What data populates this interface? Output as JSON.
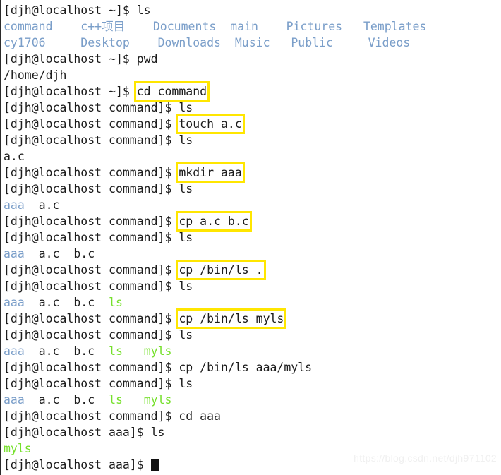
{
  "terminal": {
    "window_title": "djh@localhost",
    "colors": {
      "background": "#ffffff",
      "foreground": "#1c1c1c",
      "directory": "#7a9ec9",
      "executable": "#76e02c",
      "highlight_border": "#ffe600",
      "cursor": "#111111",
      "watermark": "#f0f0f0"
    },
    "prompts": {
      "home": "[djh@localhost ~]$ ",
      "command_dir": "[djh@localhost command]$ ",
      "aaa_dir": "[djh@localhost aaa]$ "
    },
    "lines": [
      {
        "id": "l01",
        "prompt": "home",
        "command": "ls",
        "highlight": false
      },
      {
        "id": "l02",
        "type": "output",
        "items": [
          {
            "text": "command",
            "color": "dir",
            "width": 11
          },
          {
            "text": "c++项目",
            "color": "dir",
            "width": 11
          },
          {
            "text": "Documents",
            "color": "dir",
            "width": 11
          },
          {
            "text": "main",
            "color": "dir",
            "width": 8
          },
          {
            "text": "Pictures",
            "color": "dir",
            "width": 11
          },
          {
            "text": "Templates",
            "color": "dir",
            "width": 11
          }
        ]
      },
      {
        "id": "l03",
        "type": "output",
        "items": [
          {
            "text": "cy1706",
            "color": "dir",
            "width": 11
          },
          {
            "text": "Desktop",
            "color": "dir",
            "width": 11
          },
          {
            "text": "Downloads",
            "color": "dir",
            "width": 11
          },
          {
            "text": "Music",
            "color": "dir",
            "width": 8
          },
          {
            "text": "Public",
            "color": "dir",
            "width": 11
          },
          {
            "text": "Videos",
            "color": "dir",
            "width": 11
          }
        ]
      },
      {
        "id": "l04",
        "prompt": "home",
        "command": "pwd",
        "highlight": false
      },
      {
        "id": "l05",
        "type": "output",
        "items": [
          {
            "text": "/home/djh",
            "color": "default",
            "width": 0
          }
        ]
      },
      {
        "id": "l06",
        "prompt": "home",
        "command": "cd command",
        "highlight": true
      },
      {
        "id": "l07",
        "prompt": "command_dir",
        "command": "ls",
        "highlight": false
      },
      {
        "id": "l08",
        "prompt": "command_dir",
        "command": "touch a.c",
        "highlight": true
      },
      {
        "id": "l09",
        "prompt": "command_dir",
        "command": "ls",
        "highlight": false
      },
      {
        "id": "l10",
        "type": "output",
        "items": [
          {
            "text": "a.c",
            "color": "default",
            "width": 0
          }
        ]
      },
      {
        "id": "l11",
        "prompt": "command_dir",
        "command": "mkdir aaa",
        "highlight": true
      },
      {
        "id": "l12",
        "prompt": "command_dir",
        "command": "ls",
        "highlight": false
      },
      {
        "id": "l13",
        "type": "output",
        "items": [
          {
            "text": "aaa",
            "color": "dir",
            "width": 5
          },
          {
            "text": "a.c",
            "color": "default",
            "width": 0
          }
        ]
      },
      {
        "id": "l14",
        "prompt": "command_dir",
        "command": "cp a.c b.c",
        "highlight": true
      },
      {
        "id": "l15",
        "prompt": "command_dir",
        "command": "ls",
        "highlight": false
      },
      {
        "id": "l16",
        "type": "output",
        "items": [
          {
            "text": "aaa",
            "color": "dir",
            "width": 5
          },
          {
            "text": "a.c",
            "color": "default",
            "width": 5
          },
          {
            "text": "b.c",
            "color": "default",
            "width": 0
          }
        ]
      },
      {
        "id": "l17",
        "prompt": "command_dir",
        "command": "cp /bin/ls .",
        "highlight": true
      },
      {
        "id": "l18",
        "prompt": "command_dir",
        "command": "ls",
        "highlight": false
      },
      {
        "id": "l19",
        "type": "output",
        "items": [
          {
            "text": "aaa",
            "color": "dir",
            "width": 5
          },
          {
            "text": "a.c",
            "color": "default",
            "width": 5
          },
          {
            "text": "b.c",
            "color": "default",
            "width": 5
          },
          {
            "text": "ls",
            "color": "exec",
            "width": 0
          }
        ]
      },
      {
        "id": "l20",
        "prompt": "command_dir",
        "command": "cp /bin/ls myls",
        "highlight": true
      },
      {
        "id": "l21",
        "prompt": "command_dir",
        "command": "ls",
        "highlight": false
      },
      {
        "id": "l22",
        "type": "output",
        "items": [
          {
            "text": "aaa",
            "color": "dir",
            "width": 5
          },
          {
            "text": "a.c",
            "color": "default",
            "width": 5
          },
          {
            "text": "b.c",
            "color": "default",
            "width": 5
          },
          {
            "text": "ls",
            "color": "exec",
            "width": 5
          },
          {
            "text": "myls",
            "color": "exec",
            "width": 0
          }
        ]
      },
      {
        "id": "l23",
        "prompt": "command_dir",
        "command": "cp /bin/ls aaa/myls",
        "highlight": false
      },
      {
        "id": "l24",
        "prompt": "command_dir",
        "command": "ls",
        "highlight": false
      },
      {
        "id": "l25",
        "type": "output",
        "items": [
          {
            "text": "aaa",
            "color": "dir",
            "width": 5
          },
          {
            "text": "a.c",
            "color": "default",
            "width": 5
          },
          {
            "text": "b.c",
            "color": "default",
            "width": 5
          },
          {
            "text": "ls",
            "color": "exec",
            "width": 5
          },
          {
            "text": "myls",
            "color": "exec",
            "width": 0
          }
        ]
      },
      {
        "id": "l26",
        "prompt": "command_dir",
        "command": "cd aaa",
        "highlight": false
      },
      {
        "id": "l27",
        "prompt": "aaa_dir",
        "command": "ls",
        "highlight": false
      },
      {
        "id": "l28",
        "type": "output",
        "items": [
          {
            "text": "myls",
            "color": "exec",
            "width": 0
          }
        ]
      },
      {
        "id": "l29",
        "prompt": "aaa_dir",
        "command": "",
        "highlight": false,
        "cursor": true
      }
    ]
  },
  "watermark": {
    "text": "https://blog.csdn.net/djh971102"
  }
}
